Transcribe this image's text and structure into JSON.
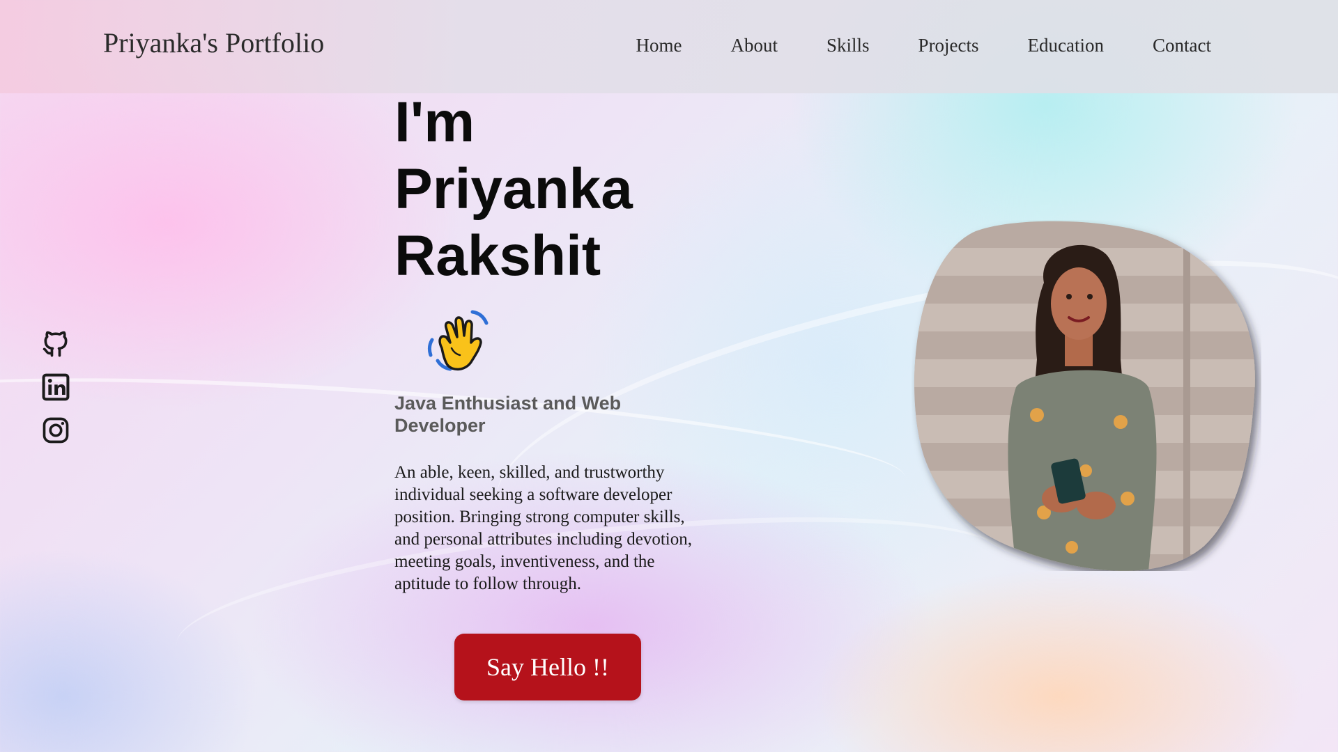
{
  "header": {
    "brand": "Priyanka's Portfolio",
    "nav": [
      "Home",
      "About",
      "Skills",
      "Projects",
      "Education",
      "Contact"
    ]
  },
  "socials": [
    "github-icon",
    "linkedin-icon",
    "instagram-icon"
  ],
  "hero": {
    "line1": "I'm",
    "line2": "Priyanka",
    "line3": "Rakshit",
    "role": "Java Enthusiast and Web Developer",
    "bio": "An able, keen, skilled, and trustworthy individual seeking a software developer position. Bringing strong computer skills, and personal attributes including devotion, meeting goals, inventiveness, and the aptitude to follow through.",
    "cta": "Say Hello !!"
  },
  "colors": {
    "cta": "#b5121b",
    "text": "#111111",
    "role": "#5a5a5a"
  }
}
